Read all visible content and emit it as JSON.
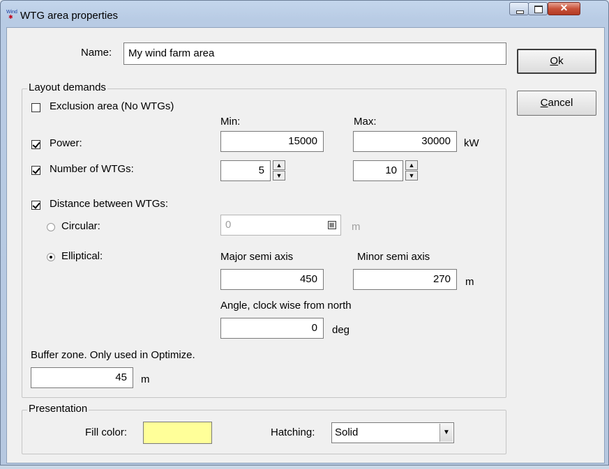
{
  "window": {
    "title": "WTG area properties"
  },
  "name": {
    "label": "Name:",
    "value": "My wind farm area"
  },
  "buttons": {
    "ok_label": "Ok",
    "cancel_label": "Cancel"
  },
  "layout": {
    "group_title": "Layout demands",
    "exclusion": {
      "label": "Exclusion area (No WTGs)",
      "checked": false
    },
    "min_header": "Min:",
    "max_header": "Max:",
    "power": {
      "label": "Power:",
      "checked": true,
      "min": "15000",
      "max": "30000",
      "unit": "kW"
    },
    "num_wtgs": {
      "label": "Number of WTGs:",
      "checked": true,
      "min": "5",
      "max": "10"
    },
    "distance": {
      "label": "Distance between WTGs:",
      "checked": true
    },
    "circular": {
      "label": "Circular:",
      "selected": false,
      "value": "0",
      "unit": "m"
    },
    "elliptical": {
      "label": "Elliptical:",
      "selected": true
    },
    "major_label": "Major semi axis",
    "minor_label": "Minor semi axis",
    "major": "450",
    "minor": "270",
    "axis_unit": "m",
    "angle_label": "Angle, clock wise from north",
    "angle": "0",
    "angle_unit": "deg",
    "buffer_label": "Buffer zone. Only used in Optimize.",
    "buffer": "45",
    "buffer_unit": "m"
  },
  "presentation": {
    "group_title": "Presentation",
    "fill_label": "Fill color:",
    "fill_color": "#ffff99",
    "hatching_label": "Hatching:",
    "hatching_value": "Solid"
  }
}
